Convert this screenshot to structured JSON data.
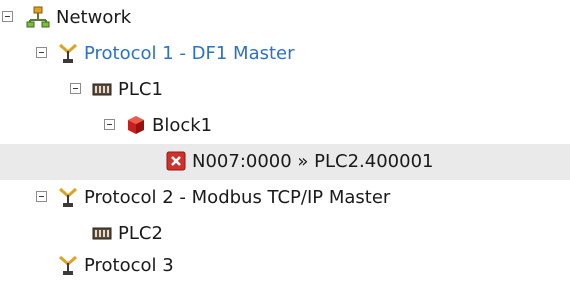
{
  "tree": {
    "network": {
      "label": "Network",
      "icon": "network-icon",
      "expanded": true
    },
    "protocol1": {
      "label": "Protocol 1 - DF1 Master",
      "icon": "protocol-antenna-icon",
      "expanded": true,
      "highlighted": true
    },
    "plc1": {
      "label": "PLC1",
      "icon": "plc-icon",
      "expanded": true
    },
    "block1": {
      "label": "Block1",
      "icon": "block-cube-icon",
      "expanded": true
    },
    "mapping": {
      "label": "N007:0000 » PLC2.400001",
      "icon": "error-x-icon",
      "selected": true
    },
    "protocol2": {
      "label": "Protocol 2 - Modbus TCP/IP Master",
      "icon": "protocol-antenna-icon",
      "expanded": true
    },
    "plc2": {
      "label": "PLC2",
      "icon": "plc-icon"
    },
    "protocol3": {
      "label": "Protocol 3",
      "icon": "protocol-antenna-icon"
    }
  },
  "colors": {
    "link": "#2a72c8",
    "selection": "#eaeaea",
    "error": "#d0312d",
    "block": "#d62020",
    "antenna": "#e0a020"
  }
}
